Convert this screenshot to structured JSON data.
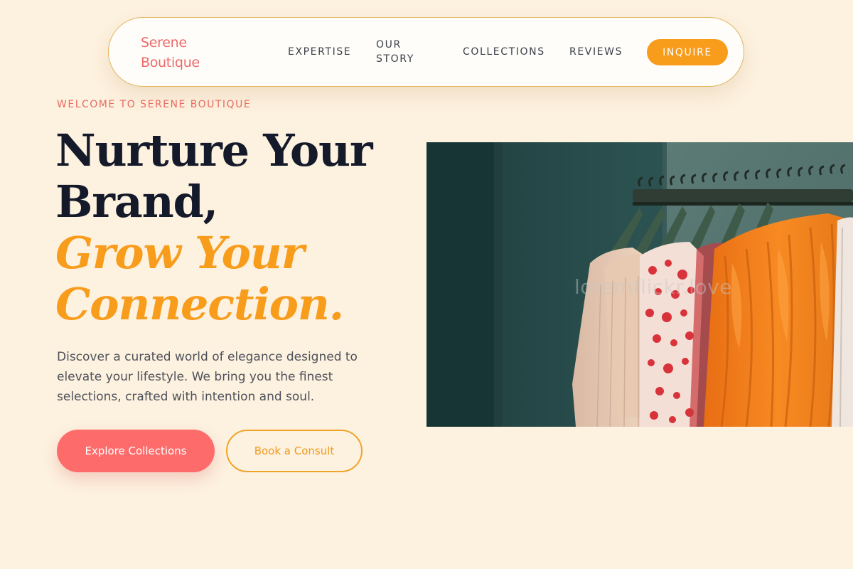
{
  "nav": {
    "brand": "Serene Boutique",
    "links": {
      "expertise": "EXPERTISE",
      "our_story_line1": "OUR",
      "our_story_line2": "STORY",
      "collections": "COLLECTIONS",
      "reviews": "REVIEWS"
    },
    "cta": "INQUIRE"
  },
  "hero": {
    "eyebrow": "WELCOME TO SERENE BOUTIQUE",
    "headline": {
      "line1": "Nurture Your",
      "line2": "Brand,",
      "line3": "Grow Your",
      "line4": "Connection."
    },
    "lede": "Discover a curated world of elegance designed to elevate your lifestyle. We bring you the finest selections, crafted with intention and soul.",
    "primary_button": "Explore Collections",
    "secondary_button": "Book a Consult",
    "image_watermark": "loremflickr.love",
    "image_subject": "clothing-rack-photo"
  },
  "colors": {
    "background": "#fdf1df",
    "brand_coral": "#ec6a6a",
    "accent_orange": "#f89c1c",
    "headline_dark": "#141a2a",
    "button_coral": "#fe6b6b"
  }
}
